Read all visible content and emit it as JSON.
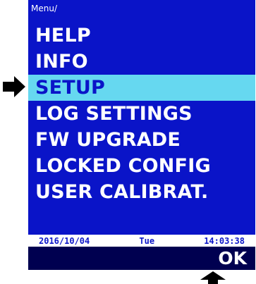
{
  "breadcrumb": "Menu/",
  "menu": {
    "items": [
      {
        "label": "HELP"
      },
      {
        "label": "INFO"
      },
      {
        "label": "SETUP"
      },
      {
        "label": "LOG  SETTINGS"
      },
      {
        "label": "FW  UPGRADE"
      },
      {
        "label": "LOCKED  CONFIG"
      },
      {
        "label": "USER CALIBRAT."
      }
    ],
    "selected_index": 2
  },
  "status": {
    "date": "2016/10/04",
    "day": "Tue",
    "time": "14:03:38"
  },
  "softkeys": {
    "right": "OK"
  },
  "colors": {
    "background": "#0a14c8",
    "selection": "#66d8f0",
    "softbar": "#000050",
    "text": "#ffffff"
  },
  "icons": {
    "selection_pointer": "arrow-right-icon",
    "softkey_pointer": "arrow-up-icon"
  }
}
